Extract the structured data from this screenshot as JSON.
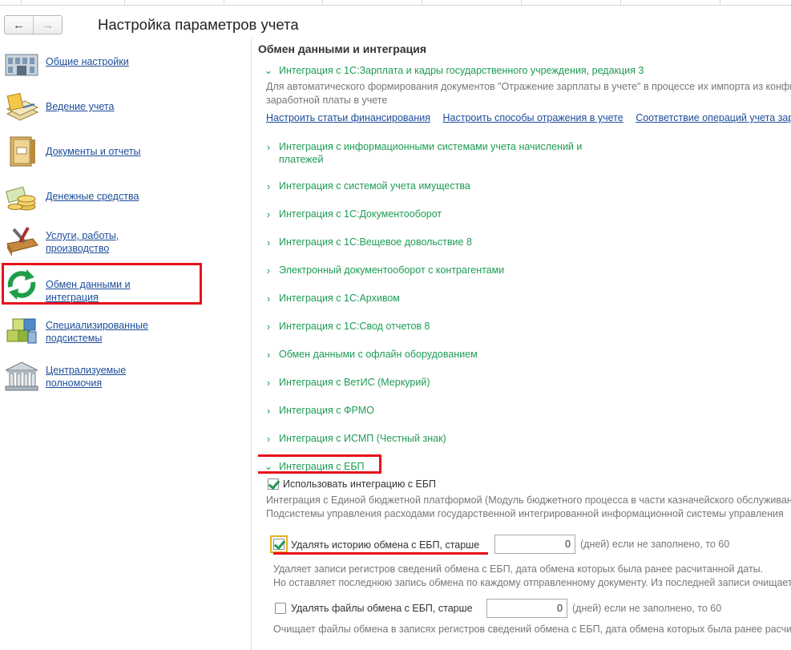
{
  "header": {
    "back_label": "←",
    "forward_label": "→",
    "title": "Настройка параметров учета"
  },
  "sidebar": {
    "items": [
      {
        "label": "Общие настройки",
        "icon": "building-icon"
      },
      {
        "label": "Ведение учета",
        "icon": "ledger-icon"
      },
      {
        "label": "Документы и отчеты",
        "icon": "binder-icon"
      },
      {
        "label": "Денежные средства",
        "icon": "coins-icon"
      },
      {
        "label": "Услуги, работы, производство",
        "icon": "tools-icon"
      },
      {
        "label": "Обмен данными и интеграция",
        "icon": "sync-icon",
        "selected": true
      },
      {
        "label": "Специализированные подсистемы",
        "icon": "cubes-icon"
      },
      {
        "label": "Централизуемые полномочия",
        "icon": "bank-icon"
      }
    ]
  },
  "main": {
    "section_title": "Обмен данными и интеграция",
    "zkgu": {
      "label": "Интеграция с 1С:Зарплата и кадры государственного учреждения, редакция 3",
      "desc_line1": "Для автоматического формирования документов \"Отражение зарплаты в учете\" в процессе их импорта из конфигурации",
      "desc_line2": "заработной платы в учете",
      "links": [
        "Настроить статьи финансирования",
        "Настроить способы отражения в учете",
        "Соответствие операций учета зарплаты"
      ]
    },
    "groups": [
      {
        "label_line1": "Интеграция с информационными системами учета начислений и",
        "label_line2": "платежей"
      },
      {
        "label_line1": "Интеграция с системой учета имущества"
      },
      {
        "label_line1": "Интеграция с 1С:Документооборот"
      },
      {
        "label_line1": "Интеграция с 1С:Вещевое довольствие 8"
      },
      {
        "label_line1": "Электронный документооборот с контрагентами"
      },
      {
        "label_line1": "Интеграция с 1С:Архивом"
      },
      {
        "label_line1": "Интеграция с 1С:Свод отчетов 8"
      },
      {
        "label_line1": "Обмен данными с офлайн оборудованием"
      },
      {
        "label_line1": "Интеграция с ВетИС (Меркурий)"
      },
      {
        "label_line1": "Интеграция с ФРМО"
      },
      {
        "label_line1": "Интеграция с ИСМП (Честный знак)"
      }
    ],
    "ebp": {
      "label": "Интеграция с ЕБП",
      "use_label": "Использовать интеграцию с ЕБП",
      "desc_line1": "Интеграция с Единой бюджетной платформой (Модуль бюджетного процесса в части казначейского обслуживания)",
      "desc_line2": "Подсистемы управления расходами государственной интегрированной информационной системы управления",
      "history": {
        "label": "Удалять историю обмена с ЕБП, старше",
        "value": "0",
        "suffix": "(дней) если не заполнено, то 60",
        "desc_line1": "Удаляет записи регистров сведений обмена с ЕБП, дата обмена которых была ранее расчитанной даты.",
        "desc_line2": "Но оставляет последнюю запись обмена по каждому отправленному документу. Из последней записи очищается"
      },
      "files": {
        "label": "Удалять файлы обмена с ЕБП, старше",
        "value": "0",
        "suffix": "(дней) если не заполнено, то 60",
        "desc_line1": "Очищает файлы обмена в записях регистров сведений обмена с ЕБП, дата обмена которых была ранее расчитанной"
      }
    }
  },
  "colors": {
    "link": "#1c4d9a",
    "group_green": "#1d9c54",
    "highlight_red": "#e8111a",
    "muted_text": "#777777"
  }
}
